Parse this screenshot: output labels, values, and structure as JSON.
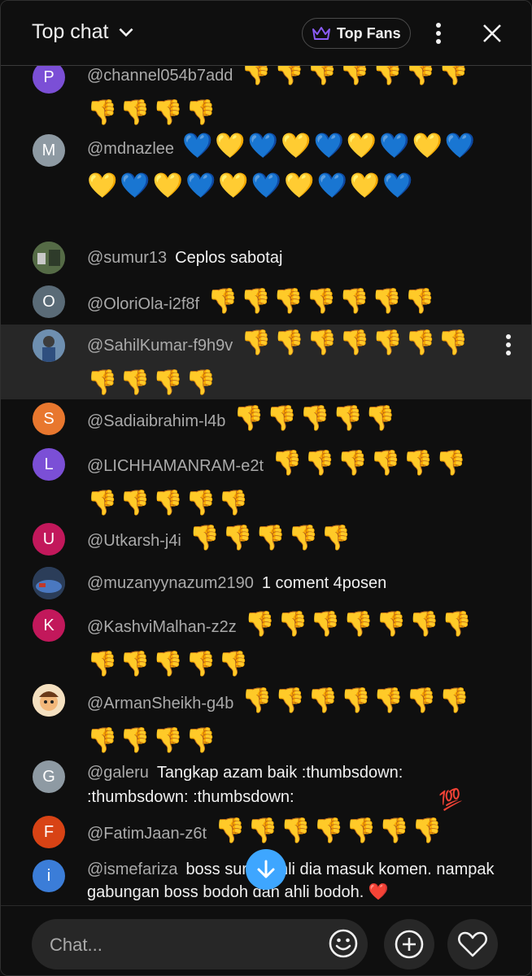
{
  "header": {
    "title": "Top chat",
    "top_fans_label": "Top Fans"
  },
  "messages": [
    {
      "author": "@channel054b7add",
      "avatar_letter": "P",
      "avatar_color": "#7b4fd6",
      "text": "👎👎👎👎👎👎👎👎👎👎👎",
      "kind": "emoji"
    },
    {
      "author": "@mdnazlee",
      "avatar_letter": "M",
      "avatar_color": "#8e9aa3",
      "text": "💙💛💙💛💙💛💙💛💙💛💙💛💙💛💙💛💙💛💙",
      "kind": "emoji"
    },
    {
      "author": "@sumur13",
      "avatar_letter": "",
      "avatar_color": "#4a5a3a",
      "text": "Ceplos sabotaj",
      "kind": "text"
    },
    {
      "author": "@OloriOla-i2f8f",
      "avatar_letter": "O",
      "avatar_color": "#5a6b77",
      "text": "👎👎👎👎👎👎👎",
      "kind": "emoji"
    },
    {
      "author": "@SahilKumar-f9h9v",
      "avatar_letter": "",
      "avatar_color": "#5a6b88",
      "text": "👎👎👎👎👎👎👎👎👎👎👎",
      "kind": "emoji"
    },
    {
      "author": "@Sadiaibrahim-l4b",
      "avatar_letter": "S",
      "avatar_color": "#e8772e",
      "text": "👎👎👎👎👎",
      "kind": "emoji"
    },
    {
      "author": "@LICHHAMANRAM-e2t",
      "avatar_letter": "L",
      "avatar_color": "#7b4fd6",
      "text": "👎👎👎👎👎👎👎👎👎👎👎",
      "kind": "emoji"
    },
    {
      "author": "@Utkarsh-j4i",
      "avatar_letter": "U",
      "avatar_color": "#c2185b",
      "text": "👎👎👎👎👎",
      "kind": "emoji"
    },
    {
      "author": "@muzanyynazum2190",
      "avatar_letter": "",
      "avatar_color": "#3d5a80",
      "text": "1 coment 4posen",
      "kind": "text"
    },
    {
      "author": "@KashviMalhan-z2z",
      "avatar_letter": "K",
      "avatar_color": "#c2185b",
      "text": "👎👎👎👎👎👎👎👎👎👎👎👎",
      "kind": "emoji"
    },
    {
      "author": "@ArmanSheikh-g4b",
      "avatar_letter": "",
      "avatar_color": "#e0b080",
      "text": "👎👎👎👎👎👎👎👎👎👎👎",
      "kind": "emoji"
    },
    {
      "author": "@galeru",
      "avatar_letter": "G",
      "avatar_color": "#8e9aa3",
      "text": "Tangkap azam baik :thumbsdown: :thumbsdown: :thumbsdown:",
      "kind": "text"
    },
    {
      "author": "@FatimJaan-z6t",
      "avatar_letter": "F",
      "avatar_color": "#d84315",
      "text": "👎👎👎👎👎👎👎",
      "kind": "emoji"
    },
    {
      "author": "@ismefariza",
      "avatar_letter": "i",
      "avatar_color": "#3b7dd8",
      "text": "boss suruh ahli dia masuk komen. nampak gabungan boss bodoh dan ahli bodoh. ❤️",
      "kind": "text"
    }
  ],
  "badge_100": "💯",
  "footer": {
    "chat_placeholder": "Chat..."
  }
}
